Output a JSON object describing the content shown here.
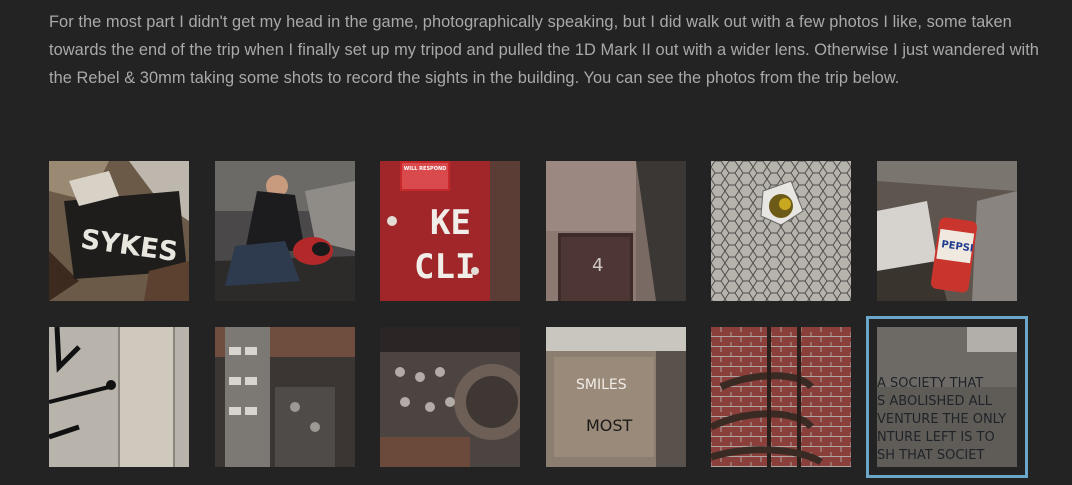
{
  "post": {
    "paragraph": "For the most part I didn't get my head in the game, photographically speaking, but I did walk out with a few photos I like, some taken towards the end of the trip when I finally set up my tripod and pulled the 1D Mark II out with a wider lens. Otherwise I just wandered with the Rebel & 30mm taking some shots to record the sights in the building. You can see the photos from the trip below."
  },
  "gallery": {
    "selected_index": 11,
    "highlight_color": "#6aa7c8",
    "thumbnails": [
      {
        "subject": "sykes-graffiti-paper",
        "graffiti_text": "SYKES"
      },
      {
        "subject": "photographer-kneeling-in-rubble"
      },
      {
        "subject": "red-door-stencil",
        "sign_text": "WILL RESPOND",
        "stencil_line1": "KE",
        "stencil_line2": "CLI"
      },
      {
        "subject": "brick-doorway-number",
        "door_number": "4"
      },
      {
        "subject": "hole-in-wired-glass"
      },
      {
        "subject": "pepsi-can-in-debris",
        "can_text": "PEPSI"
      },
      {
        "subject": "graffiti-on-wood-panel"
      },
      {
        "subject": "electrical-panel-rack"
      },
      {
        "subject": "control-panel-switches"
      },
      {
        "subject": "metal-door-tags",
        "tag_line1": "SMILES",
        "tag_line2": "MOST"
      },
      {
        "subject": "spiral-staircase-brick-wall"
      },
      {
        "subject": "society-graffiti-wall",
        "wall_text": [
          "A SOCIETY THAT",
          "S ABOLISHED ALL",
          "VENTURE THE ONLY",
          "NTURE LEFT IS TO",
          "SH THAT SOCIET"
        ]
      }
    ]
  }
}
